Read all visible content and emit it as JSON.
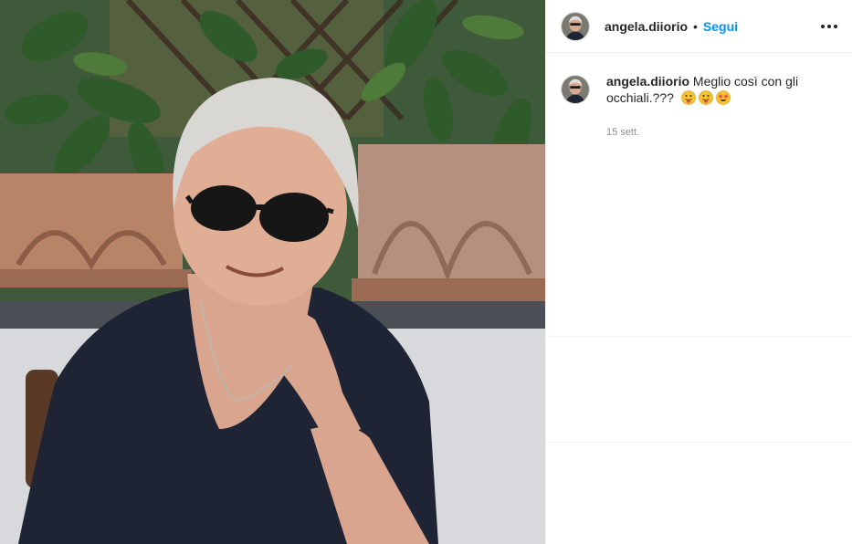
{
  "post": {
    "username": "angela.diiorio",
    "separator": "•",
    "follow_label": "Segui",
    "more_icon": "more-options-icon"
  },
  "caption": {
    "username": "angela.diiorio",
    "text_line1": "Meglio così con gli",
    "text_line2": "occhiali.???",
    "emojis": [
      "face-with-tongue-icon",
      "face-with-tongue-icon",
      "star-struck-icon"
    ],
    "time": "15 sett."
  },
  "colors": {
    "follow": "#0095f6",
    "muted": "#8e8e8e",
    "text": "#262626"
  }
}
